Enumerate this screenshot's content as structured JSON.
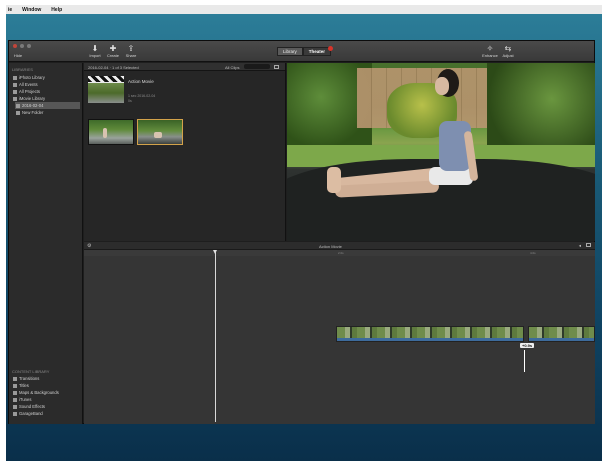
{
  "menubar": {
    "items": [
      "ie",
      "Window",
      "Help"
    ]
  },
  "toolbar": {
    "sidebar_label": "Hide",
    "import_label": "Import",
    "create_label": "Create",
    "share_label": "Share",
    "library_tab": "Library",
    "theater_tab": "Theater",
    "enhance_label": "Enhance",
    "adjust_label": "Adjust"
  },
  "sidebar": {
    "libraries_header": "Libraries",
    "items": [
      {
        "label": "iPhoto Library"
      },
      {
        "label": "All Events"
      },
      {
        "label": "All Projects"
      },
      {
        "label": "iMovie Library"
      },
      {
        "label": "2016-02-04"
      },
      {
        "label": "New Folder"
      }
    ],
    "content_header": "Content Library",
    "content_items": [
      {
        "label": "Transitions"
      },
      {
        "label": "Titles"
      },
      {
        "label": "Maps & Backgrounds"
      },
      {
        "label": "iTunes"
      },
      {
        "label": "Sound Effects"
      },
      {
        "label": "GarageBand"
      }
    ]
  },
  "browser": {
    "header_left": "2016-02-04  ·  1 of 3 Selected",
    "zoom_label": "All Clips",
    "project_title": "Action Movie",
    "project_meta": "1 sec 2016-02-04",
    "project_meta2": "0s"
  },
  "timeline": {
    "project_name": "Action Movie",
    "ruler_t1": "2.0s",
    "ruler_t2": "4.0s",
    "clip_duration": "+0.9s"
  },
  "colors": {
    "accent_selection": "#d3a24a",
    "audio_track": "#3d6b9c",
    "badge_red": "#d6342a"
  }
}
